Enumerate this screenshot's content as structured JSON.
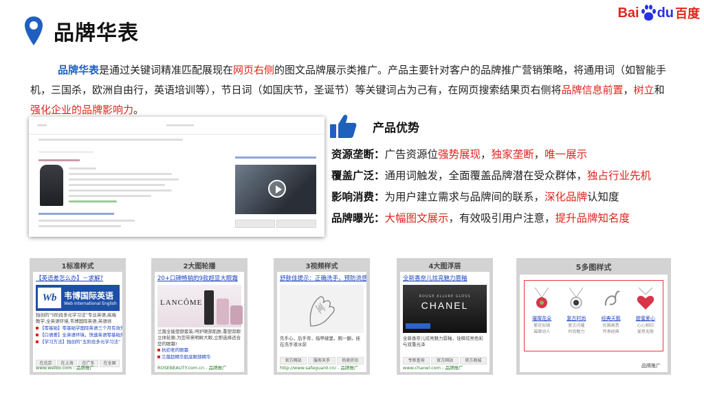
{
  "page": {
    "title": "品牌华表",
    "logo": {
      "bai": "Bai",
      "du": "du",
      "cn": "百度"
    }
  },
  "intro": {
    "s1_blue": "品牌华表",
    "s2": "是通过关键词精准匹配展现在",
    "s3_red": "网页右侧",
    "s4": "的图文品牌展示类推广。产品主要针对客户的品牌推广营销策略，将通用词（如智能手机，三国杀，欧洲自由行，英语培训等），节日词（如国庆节，圣诞节）等关键词占为己有，在网页搜索结果页右侧将",
    "s5_red": "品牌信息前置",
    "s6": "，",
    "s7_red": "树立",
    "s8": "和",
    "s9_red": "强化企业的品牌影响力",
    "s10": "。"
  },
  "advantages": {
    "title": "产品优势",
    "rows": [
      {
        "label": "资源垄断：",
        "t1": "广告资源位",
        "r1": "强势展现",
        "t2": "，",
        "r2": "独家垄断",
        "t3": "，",
        "r3": "唯一展示",
        "t4": ""
      },
      {
        "label": "覆盖广泛：",
        "t1": "通用词触发，全面覆盖品牌潜在受众群体，",
        "r1": "独占行业先机",
        "t2": "",
        "r2": "",
        "t3": "",
        "r3": "",
        "t4": ""
      },
      {
        "label": "影响消费：",
        "t1": "为用户建立需求与品牌间的联系，",
        "r1": "深化品牌",
        "t2": "认知度",
        "r2": "",
        "t3": "",
        "r3": "",
        "t4": ""
      },
      {
        "label": "品牌曝光：",
        "t1": "",
        "r1": "大幅图文展示",
        "t2": "，有效吸引用户注意，",
        "r2": "提升品牌知名度",
        "t3": "",
        "r3": "",
        "t4": ""
      }
    ]
  },
  "cards": [
    {
      "title": "1标准样式",
      "head": "【英语差怎么办】－求解?",
      "brand": "韦博国际英语",
      "brand_en": "Web International English",
      "desc": "独创的“5阶段多元学习法”专业英语,高端教学,全英语环境,韦博国际英语,英语培训...",
      "links": [
        "【零基础】零基础学国际英语三个月有效外语培训",
        "【口语差】全英语环境，快速英语零基础外教",
        "【学习方法】独创的“五阶段多元学习法”"
      ],
      "buttons": [
        "在北京",
        "在上海",
        "在广东",
        "在全国"
      ],
      "foot": "www.weibo.com - 品牌推广"
    },
    {
      "title": "2大图轮播",
      "head": "20+口碑畅销的9款超显大眼霜",
      "brand": "LANCÔME",
      "desc": "兰蔻全能塑颜套装,呵护眼部肌肤,重塑双眼立体轮廓,为您带来明眸大眼,立即选择适合您的眼霜!",
      "links": [
        "抗初老的眼霜",
        "兰蔻超精华肌底眼部精华"
      ],
      "foot": "ROSEBEAUTY.com.cn - 品牌推广"
    },
    {
      "title": "3视频样式",
      "head": "舒肤佳提示：正确洗手，预防流感",
      "desc": "先手心，后手背，指甲缝里，腕一翻，挂在洗手液水前",
      "buttons": [
        "官方网站",
        "服务天手",
        "热卖折扣"
      ],
      "foot": "http://www.safeguard.cn/ - 品牌推广"
    },
    {
      "title": "4大图浮层",
      "head": "全新香奈儿炫亮魅力唇釉",
      "brand": "CHANEL",
      "brand_sub": "ROUGE ALLURE GLOSS",
      "desc": "全新香奈儿炫亮魅力唇釉，诠释炫亮色彩与双重光泽",
      "buttons": [
        "专柜查询",
        "官方网站",
        "官方商城"
      ],
      "foot": "www.chanel.com - 品牌推广"
    },
    {
      "title": "5多图样式",
      "products": [
        {
          "name": "璀璨花朵",
          "d1": "繁花似锦",
          "d2": "璀璨动人"
        },
        {
          "name": "复古时尚",
          "d1": "复古闪耀",
          "d2": "时尚魅力"
        },
        {
          "name": "经典天鹅",
          "d1": "优雅高贵",
          "d2": "传承经典"
        },
        {
          "name": "甜蜜爱心",
          "d1": "心心相印",
          "d2": "爱意无限"
        }
      ],
      "foot": "品牌推广"
    }
  ],
  "colors": {
    "accent_blue": "#1f5fbf",
    "accent_red": "#e0231c",
    "baidu_blue": "#2932e1"
  }
}
